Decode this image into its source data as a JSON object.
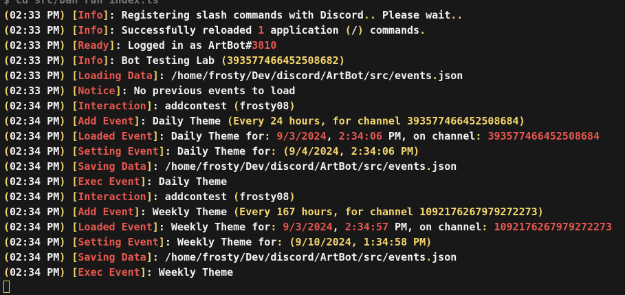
{
  "colors": {
    "background": "#181818",
    "text": "#f2f2f2",
    "yellow": "#f5d76e",
    "red": "#e8574f",
    "cyan": "#5dd8e0",
    "dim": "#777777"
  },
  "terminal": {
    "lines": [
      [
        {
          "t": "$ cd src/Dan run index.ts",
          "c": "dim"
        }
      ],
      [
        {
          "t": "(",
          "c": "yellow"
        },
        {
          "t": "02:33 PM",
          "c": "text"
        },
        {
          "t": ") [",
          "c": "yellow"
        },
        {
          "t": "Info",
          "c": "red"
        },
        {
          "t": "]",
          "c": "yellow"
        },
        {
          "t": ": Registering slash commands with Discord",
          "c": "text"
        },
        {
          "t": "..",
          "c": "yellow"
        },
        {
          "t": " Please wait",
          "c": "text"
        },
        {
          "t": "..",
          "c": "yellow"
        }
      ],
      [
        {
          "t": "(",
          "c": "yellow"
        },
        {
          "t": "02:33 PM",
          "c": "text"
        },
        {
          "t": ") [",
          "c": "yellow"
        },
        {
          "t": "Info",
          "c": "red"
        },
        {
          "t": "]",
          "c": "yellow"
        },
        {
          "t": ": Successfully reloaded ",
          "c": "text"
        },
        {
          "t": "1",
          "c": "red"
        },
        {
          "t": " application ",
          "c": "text"
        },
        {
          "t": "(",
          "c": "yellow"
        },
        {
          "t": "/",
          "c": "text"
        },
        {
          "t": ")",
          "c": "yellow"
        },
        {
          "t": " commands",
          "c": "text"
        },
        {
          "t": ".",
          "c": "yellow"
        }
      ],
      [
        {
          "t": "(",
          "c": "yellow"
        },
        {
          "t": "02:33 PM",
          "c": "text"
        },
        {
          "t": ") [",
          "c": "yellow"
        },
        {
          "t": "Ready",
          "c": "red"
        },
        {
          "t": "]",
          "c": "yellow"
        },
        {
          "t": ": Logged in as ArtBot#",
          "c": "text"
        },
        {
          "t": "3810",
          "c": "red"
        }
      ],
      [
        {
          "t": "(",
          "c": "yellow"
        },
        {
          "t": "02:33 PM",
          "c": "text"
        },
        {
          "t": ") [",
          "c": "yellow"
        },
        {
          "t": "Info",
          "c": "red"
        },
        {
          "t": "]",
          "c": "yellow"
        },
        {
          "t": ": Bot Testing Lab ",
          "c": "text"
        },
        {
          "t": "(",
          "c": "yellow"
        },
        {
          "t": "393577466452508682",
          "c": "yellow"
        },
        {
          "t": ")",
          "c": "yellow"
        }
      ],
      [
        {
          "t": "(",
          "c": "yellow"
        },
        {
          "t": "02:33 PM",
          "c": "text"
        },
        {
          "t": ") [",
          "c": "yellow"
        },
        {
          "t": "Loading Data",
          "c": "red"
        },
        {
          "t": "]",
          "c": "yellow"
        },
        {
          "t": ": /home/frosty/Dev/discord/ArtBot/src/events",
          "c": "text"
        },
        {
          "t": ".",
          "c": "yellow"
        },
        {
          "t": "json",
          "c": "text"
        }
      ],
      [
        {
          "t": "(",
          "c": "yellow"
        },
        {
          "t": "02:33 PM",
          "c": "text"
        },
        {
          "t": ") [",
          "c": "yellow"
        },
        {
          "t": "Notice",
          "c": "red"
        },
        {
          "t": "]",
          "c": "yellow"
        },
        {
          "t": ": No previous events to load",
          "c": "text"
        }
      ],
      [
        {
          "t": "(",
          "c": "yellow"
        },
        {
          "t": "02:34 PM",
          "c": "text"
        },
        {
          "t": ") [",
          "c": "yellow"
        },
        {
          "t": "Interaction",
          "c": "red"
        },
        {
          "t": "]",
          "c": "yellow"
        },
        {
          "t": ": addcontest ",
          "c": "text"
        },
        {
          "t": "(",
          "c": "yellow"
        },
        {
          "t": "frosty08",
          "c": "text"
        },
        {
          "t": ")",
          "c": "yellow"
        }
      ],
      [
        {
          "t": "(",
          "c": "yellow"
        },
        {
          "t": "02:34 PM",
          "c": "text"
        },
        {
          "t": ") [",
          "c": "yellow"
        },
        {
          "t": "Add Event",
          "c": "red"
        },
        {
          "t": "]",
          "c": "yellow"
        },
        {
          "t": ": Daily Theme ",
          "c": "text"
        },
        {
          "t": "(Every 24 hours, for channel 393577466452508684)",
          "c": "yellow"
        }
      ],
      [
        {
          "t": "(",
          "c": "yellow"
        },
        {
          "t": "02:34 PM",
          "c": "text"
        },
        {
          "t": ") [",
          "c": "yellow"
        },
        {
          "t": "Loaded Event",
          "c": "red"
        },
        {
          "t": "]",
          "c": "yellow"
        },
        {
          "t": ": Daily Theme for",
          "c": "text"
        },
        {
          "t": ": ",
          "c": "yellow"
        },
        {
          "t": "9/3/2024",
          "c": "red"
        },
        {
          "t": ", ",
          "c": "text"
        },
        {
          "t": "2:34:06",
          "c": "red"
        },
        {
          "t": " PM, on channel",
          "c": "text"
        },
        {
          "t": ": ",
          "c": "yellow"
        },
        {
          "t": "393577466452508684",
          "c": "red"
        }
      ],
      [
        {
          "t": "(",
          "c": "yellow"
        },
        {
          "t": "02:34 PM",
          "c": "text"
        },
        {
          "t": ") [",
          "c": "yellow"
        },
        {
          "t": "Setting Event",
          "c": "red"
        },
        {
          "t": "]",
          "c": "yellow"
        },
        {
          "t": ": Daily Theme for",
          "c": "text"
        },
        {
          "t": ": ",
          "c": "yellow"
        },
        {
          "t": "(9/4/2024, 2:34:06 PM)",
          "c": "yellow"
        }
      ],
      [
        {
          "t": "(",
          "c": "yellow"
        },
        {
          "t": "02:34 PM",
          "c": "text"
        },
        {
          "t": ") [",
          "c": "yellow"
        },
        {
          "t": "Saving Data",
          "c": "red"
        },
        {
          "t": "]",
          "c": "yellow"
        },
        {
          "t": ": /home/frosty/Dev/discord/ArtBot/src/events",
          "c": "text"
        },
        {
          "t": ".",
          "c": "yellow"
        },
        {
          "t": "json",
          "c": "text"
        }
      ],
      [
        {
          "t": "(",
          "c": "yellow"
        },
        {
          "t": "02:34 PM",
          "c": "text"
        },
        {
          "t": ") [",
          "c": "yellow"
        },
        {
          "t": "Exec Event",
          "c": "red"
        },
        {
          "t": "]",
          "c": "yellow"
        },
        {
          "t": ": Daily Theme",
          "c": "text"
        }
      ],
      [
        {
          "t": "(",
          "c": "yellow"
        },
        {
          "t": "02:34 PM",
          "c": "text"
        },
        {
          "t": ") [",
          "c": "yellow"
        },
        {
          "t": "Interaction",
          "c": "red"
        },
        {
          "t": "]",
          "c": "yellow"
        },
        {
          "t": ": addcontest ",
          "c": "text"
        },
        {
          "t": "(",
          "c": "yellow"
        },
        {
          "t": "frosty08",
          "c": "text"
        },
        {
          "t": ")",
          "c": "yellow"
        }
      ],
      [
        {
          "t": "(",
          "c": "yellow"
        },
        {
          "t": "02:34 PM",
          "c": "text"
        },
        {
          "t": ") [",
          "c": "yellow"
        },
        {
          "t": "Add Event",
          "c": "red"
        },
        {
          "t": "]",
          "c": "yellow"
        },
        {
          "t": ": Weekly Theme ",
          "c": "text"
        },
        {
          "t": "(Every 167 hours, for channel 1092176267979272273)",
          "c": "yellow"
        }
      ],
      [
        {
          "t": "(",
          "c": "yellow"
        },
        {
          "t": "02:34 PM",
          "c": "text"
        },
        {
          "t": ") [",
          "c": "yellow"
        },
        {
          "t": "Loaded Event",
          "c": "red"
        },
        {
          "t": "]",
          "c": "yellow"
        },
        {
          "t": ": Weekly Theme for",
          "c": "text"
        },
        {
          "t": ": ",
          "c": "yellow"
        },
        {
          "t": "9/3/2024",
          "c": "red"
        },
        {
          "t": ", ",
          "c": "text"
        },
        {
          "t": "2:34:57",
          "c": "red"
        },
        {
          "t": " PM, on channel",
          "c": "text"
        },
        {
          "t": ": ",
          "c": "yellow"
        },
        {
          "t": "1092176267979272273",
          "c": "red"
        }
      ],
      [
        {
          "t": "(",
          "c": "yellow"
        },
        {
          "t": "02:34 PM",
          "c": "text"
        },
        {
          "t": ") [",
          "c": "yellow"
        },
        {
          "t": "Setting Event",
          "c": "red"
        },
        {
          "t": "]",
          "c": "yellow"
        },
        {
          "t": ": Weekly Theme for",
          "c": "text"
        },
        {
          "t": ": ",
          "c": "yellow"
        },
        {
          "t": "(9/10/2024, 1:34:58 PM)",
          "c": "yellow"
        }
      ],
      [
        {
          "t": "(",
          "c": "yellow"
        },
        {
          "t": "02:34 PM",
          "c": "text"
        },
        {
          "t": ") [",
          "c": "yellow"
        },
        {
          "t": "Saving Data",
          "c": "red"
        },
        {
          "t": "]",
          "c": "yellow"
        },
        {
          "t": ": /home/frosty/Dev/discord/ArtBot/src/events",
          "c": "text"
        },
        {
          "t": ".",
          "c": "yellow"
        },
        {
          "t": "json",
          "c": "text"
        }
      ],
      [
        {
          "t": "(",
          "c": "yellow"
        },
        {
          "t": "02:34 PM",
          "c": "text"
        },
        {
          "t": ") [",
          "c": "yellow"
        },
        {
          "t": "Exec Event",
          "c": "red"
        },
        {
          "t": "]",
          "c": "yellow"
        },
        {
          "t": ": Weekly Theme",
          "c": "text"
        }
      ]
    ]
  }
}
